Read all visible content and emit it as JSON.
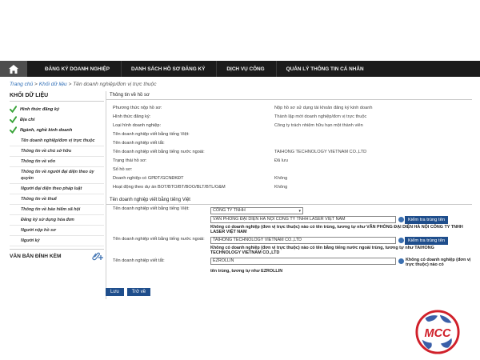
{
  "nav": {
    "items": [
      {
        "label": "ĐĂNG KÝ DOANH NGHIỆP"
      },
      {
        "label": "DANH SÁCH HỒ SƠ ĐĂNG KÝ"
      },
      {
        "label": "DỊCH VỤ CÔNG"
      },
      {
        "label": "QUẢN LÝ THÔNG TIN CÁ NHÂN"
      }
    ]
  },
  "breadcrumb": {
    "home": "Trang chủ",
    "sep": ">",
    "data": "Khối dữ liệu",
    "current": "Tên doanh nghiệp/đơn vị trực thuộc"
  },
  "sidebar": {
    "heading": "KHỐI DỮ LIỆU",
    "checked": [
      {
        "label": "Hình thức đăng ký"
      },
      {
        "label": "Địa chỉ"
      },
      {
        "label": "Ngành, nghề kinh doanh"
      }
    ],
    "subs": [
      {
        "label": "Tên doanh nghiệp/đơn vị trực thuộc"
      },
      {
        "label": "Thông tin về chủ sở hữu"
      },
      {
        "label": "Thông tin về vốn"
      },
      {
        "label": "Thông tin về người đại diện theo ủy quyền"
      },
      {
        "label": "Người đại diện theo pháp luật"
      },
      {
        "label": "Thông tin về thuế"
      },
      {
        "label": "Thông tin về bảo hiểm xã hội"
      },
      {
        "label": "Đăng ký sử dụng hóa đơn"
      },
      {
        "label": "Người nộp hồ sơ"
      },
      {
        "label": "Người ký"
      }
    ],
    "attach": "VĂN BẢN ĐÍNH KÈM"
  },
  "profile": {
    "title": "Thông tin về hồ sơ",
    "rows": [
      {
        "label": "Phương thức nộp hồ sơ:",
        "value": "Nộp hồ sơ sử dụng tài khoản đăng ký kinh doanh"
      },
      {
        "label": "Hình thức đăng ký:",
        "value": "Thành lập mới doanh nghiệp/đơn vị trực thuộc"
      },
      {
        "label": "Loại hình doanh nghiệp:",
        "value": "Công ty trách nhiệm hữu hạn một thành viên"
      },
      {
        "label": "Tên doanh nghiệp viết bằng tiếng Việt:",
        "value": ""
      },
      {
        "label": "Tên doanh nghiệp viết tắt:",
        "value": ""
      },
      {
        "label": "Tên doanh nghiệp viết bằng tiếng nước ngoài:",
        "value": "TAIHONG TECHNOLOGY VIETNAM CO.,LTD"
      },
      {
        "label": "Trạng thái hồ sơ:",
        "value": "Đã lưu"
      },
      {
        "label": "Số hồ sơ:",
        "value": ""
      },
      {
        "label": "Doanh nghiệp có GPĐT/GCNĐKĐT",
        "value": "Không"
      },
      {
        "label": "Hoạt động theo dự án BOT/BTO/BT/BOO/BLT/BTL/O&M",
        "value": "Không"
      }
    ]
  },
  "names": {
    "title": "Tên doanh nghiệp viết bằng tiếng Việt",
    "vn_label": "Tên doanh nghiệp viết bằng tiếng Việt:",
    "vn_select": "CÔNG TY TNHH",
    "vn_value": "VĂN PHÒNG ĐẠI DIỆN HÀ NỘI CÔNG TY TNHH LASER VIỆT NAM",
    "vn_warn": "Không có doanh nghiệp (đơn vị trực thuộc) nào có tên trùng, tương tự như VĂN PHÒNG ĐẠI DIỆN HÀ NỘI CÔNG TY TNHH LASER VIỆT NAM",
    "fr_label": "Tên doanh nghiệp viết bằng tiếng nước ngoài:",
    "fr_value": "TAIHONG TECHNOLOGY VIETNAM CO.,LTD",
    "fr_warn": "Không có doanh nghiệp (đơn vị trực thuộc) nào có tên bằng tiếng nước ngoài trùng, tương tự như TAIHONG TECHNOLOGY VIETNAM CO.,LTD",
    "ab_label": "Tên doanh nghiệp viết tắt:",
    "ab_value": "EZROLLIN",
    "ab_warn_right": "Không có doanh nghiệp (đơn vị trực thuộc) nào có",
    "ab_warn_below": "tên trùng, tương tự như EZROLLIN",
    "check_btn": "Kiểm tra trùng tên"
  },
  "actions": {
    "save": "Lưu",
    "back": "Trở về"
  },
  "logo": {
    "text": "MCC",
    "colors": {
      "red": "#d0202a",
      "blue": "#3a5fa8"
    }
  },
  "colors": {
    "nav_bg": "#1b1b1b",
    "button_blue": "#1f4e8c",
    "link_blue": "#2a6bb5",
    "check_green": "#3aa43a"
  }
}
